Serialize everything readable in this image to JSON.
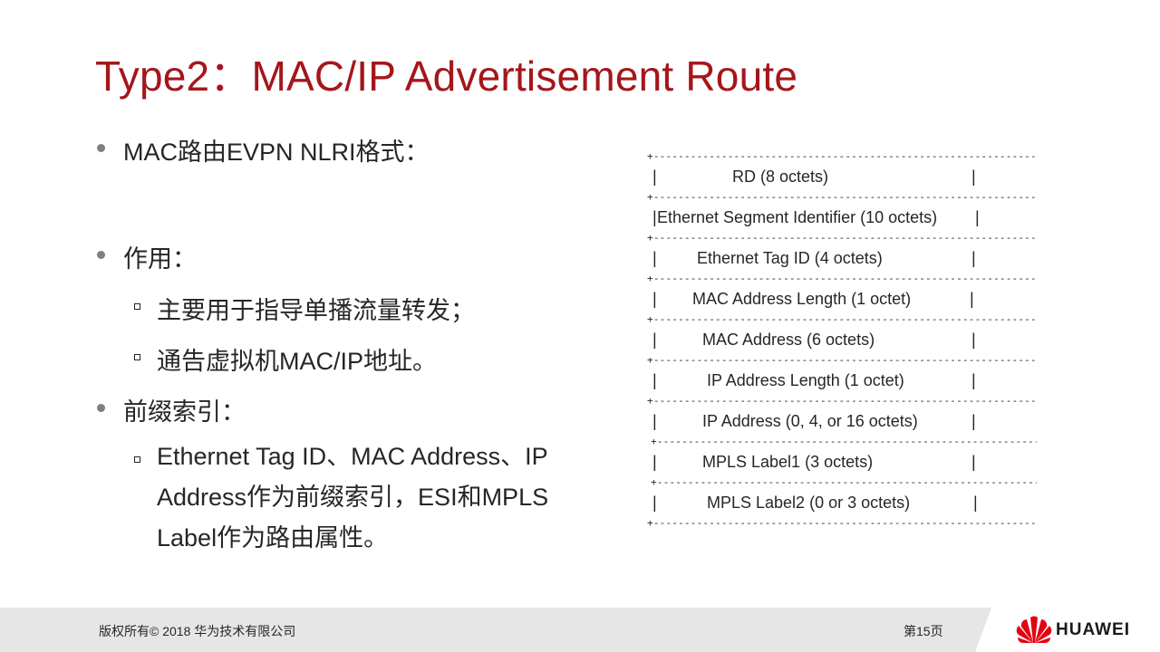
{
  "title": "Type2：MAC/IP Advertisement Route",
  "bullets": {
    "b1": "MAC路由EVPN  NLRI格式：",
    "b2": "作用：",
    "b2_sub1": "主要用于指导单播流量转发；",
    "b2_sub2": "通告虚拟机MAC/IP地址。",
    "b3": "前缀索引：",
    "b3_sub1": "Ethernet Tag ID、MAC Address、IP Address作为前缀索引，ESI和MPLS Label作为路由属性。"
  },
  "nlri": {
    "separator": "+--------------------------------------------------------------+",
    "bar": "|",
    "fields": [
      "RD (8 octets)",
      "Ethernet Segment Identifier (10 octets)",
      "Ethernet Tag ID (4 octets)",
      "MAC Address Length (1 octet)",
      "MAC Address (6 octets)",
      "IP Address Length (1 octet)",
      "IP Address (0, 4, or 16 octets)",
      "MPLS Label1 (3 octets)",
      "MPLS Label2 (0 or 3 octets)"
    ]
  },
  "footer": {
    "copyright": "版权所有© 2018 华为技术有限公司",
    "page": "第15页",
    "brand": "HUAWEI",
    "brand_color": "#e60012"
  },
  "colors": {
    "title": "#a5161b",
    "footer_bg": "#e7e6e6"
  }
}
